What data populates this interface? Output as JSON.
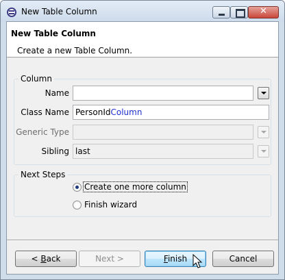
{
  "window": {
    "title": "New Table Column"
  },
  "header": {
    "title": "New Table Column",
    "description": "Create a new Table Column."
  },
  "column_group": {
    "label": "Column",
    "name": {
      "label": "Name",
      "value": ""
    },
    "class_name": {
      "label": "Class Name",
      "value_prefix": "PersonId",
      "value_suffix": "Column"
    },
    "generic_type": {
      "label": "Generic Type",
      "value": ""
    },
    "sibling": {
      "label": "Sibling",
      "value": "last"
    }
  },
  "next_steps_group": {
    "label": "Next Steps",
    "options": [
      {
        "label": "Create one more column",
        "checked": true
      },
      {
        "label": "Finish wizard",
        "checked": false
      }
    ]
  },
  "buttons": {
    "back_prefix": "< ",
    "back_mnemonic": "B",
    "back_rest": "ack",
    "next": "Next >",
    "finish_mnemonic": "F",
    "finish_rest": "inish",
    "cancel": "Cancel"
  },
  "colors": {
    "title_bar_top": "#e3ecf6",
    "class_name_suffix": "#1e2ecf",
    "default_button": "#3c7fb1"
  }
}
